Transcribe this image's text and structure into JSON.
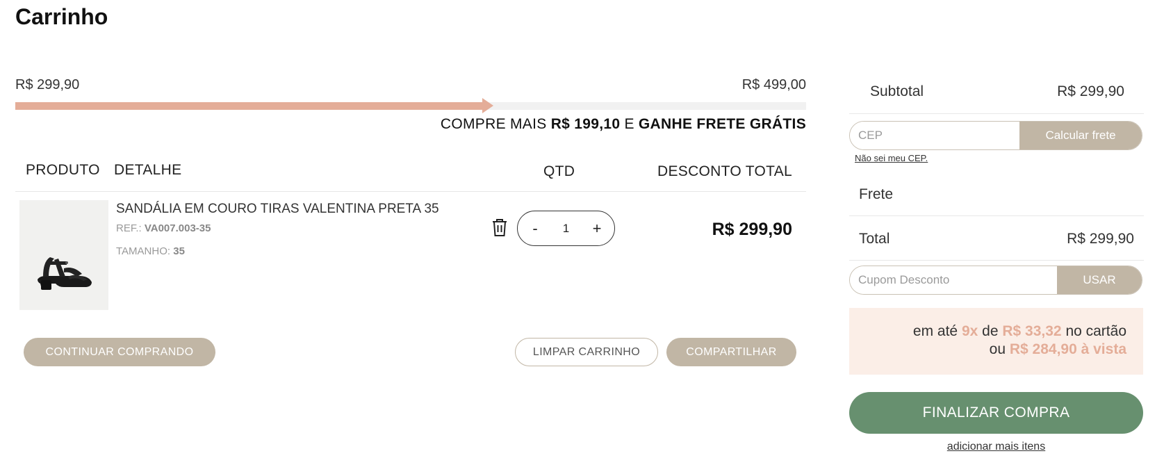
{
  "page": {
    "title": "Carrinho"
  },
  "shipping_progress": {
    "min_label": "R$ 299,90",
    "max_label": "R$ 499,00",
    "progress_fraction": 0.601,
    "msg_prefix": "COMPRE MAIS",
    "msg_amount": "R$ 199,10",
    "msg_mid": "E",
    "msg_suffix": "GANHE FRETE GRÁTIS",
    "color": "#e4ad98"
  },
  "table": {
    "headers": {
      "product": "PRODUTO",
      "detail": "DETALHE",
      "qty": "QTD",
      "total": "DESCONTO TOTAL"
    }
  },
  "items": [
    {
      "name": "SANDÁLIA EM COURO TIRAS VALENTINA PRETA 35",
      "ref_label": "REF.:",
      "ref_value": "VA007.003-35",
      "size_label": "TAMANHO:",
      "size_value": "35",
      "qty_minus": "-",
      "qty": "1",
      "qty_plus": "+",
      "total": "R$ 299,90",
      "image_icon": "sandal-image"
    }
  ],
  "actions": {
    "continue": "CONTINUAR COMPRANDO",
    "clear": "LIMPAR CARRINHO",
    "share": "COMPARTILHAR"
  },
  "summary": {
    "subtotal_label": "Subtotal",
    "subtotal_value": "R$ 299,90",
    "cep_placeholder": "CEP",
    "cep_button": "Calcular frete",
    "cep_help": "Não sei meu CEP.",
    "shipping_label": "Frete",
    "total_label": "Total",
    "total_value": "R$ 299,90",
    "coupon_placeholder": "Cupom Desconto",
    "coupon_button": "USAR",
    "install_prefix": "em até",
    "install_count": "9x",
    "install_de": "de",
    "install_amount": "R$ 33,32",
    "install_suffix": "no cartão",
    "cash_prefix": "ou",
    "cash_value": "R$ 284,90 à vista",
    "finalize": "FINALIZAR COMPRA",
    "add_more": "adicionar mais itens"
  },
  "colors": {
    "taupe": "#c1b6a5",
    "green": "#67906f",
    "peach": "#e4ad98",
    "peach_bg": "#fbeee7"
  }
}
